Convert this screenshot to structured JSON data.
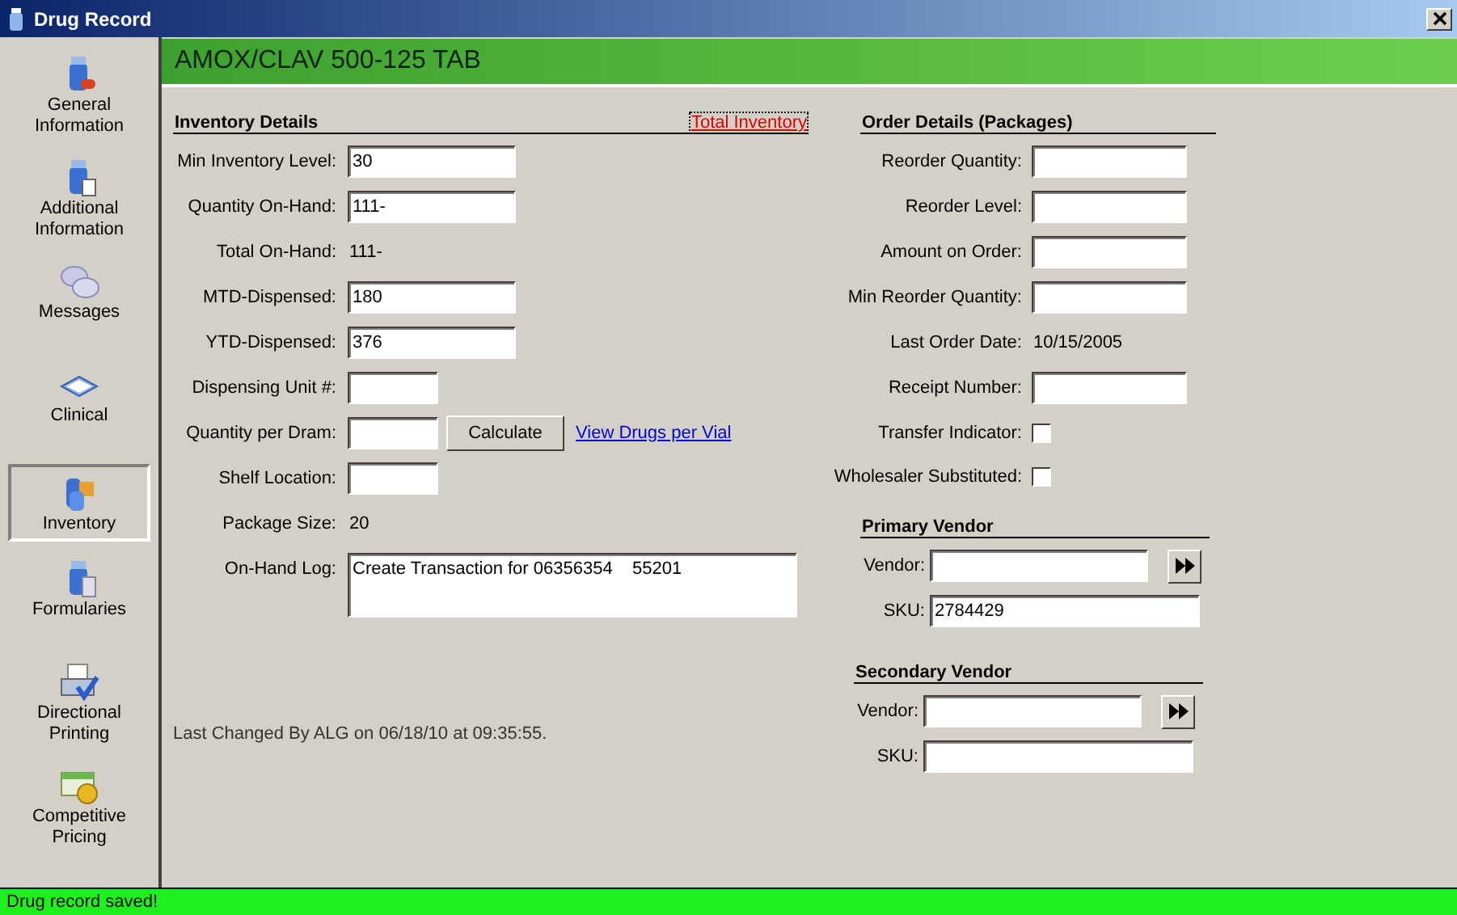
{
  "window": {
    "title": "Drug Record"
  },
  "sidebar": {
    "items": [
      {
        "label": "General Information",
        "selected": false
      },
      {
        "label": "Additional Information",
        "selected": false
      },
      {
        "label": "Messages",
        "selected": false
      },
      {
        "label": "Clinical",
        "selected": false
      },
      {
        "label": "Inventory",
        "selected": true
      },
      {
        "label": "Formularies",
        "selected": false
      },
      {
        "label": "Directional Printing",
        "selected": false
      },
      {
        "label": "Competitive Pricing",
        "selected": false
      }
    ]
  },
  "header": {
    "title": "AMOX/CLAV 500-125 TAB"
  },
  "inventory_details": {
    "title": "Inventory Details",
    "link": "Total Inventory",
    "rows": [
      {
        "kind": "field",
        "label": "Min Inventory Level:",
        "value": "30"
      },
      {
        "kind": "field",
        "label": "Quantity On-Hand:",
        "value": "111-"
      },
      {
        "kind": "text",
        "label": "Total On-Hand:",
        "value": "111-"
      },
      {
        "kind": "field",
        "label": "MTD-Dispensed:",
        "value": "180"
      },
      {
        "kind": "field",
        "label": "YTD-Dispensed:",
        "value": "376"
      },
      {
        "kind": "short",
        "label": "Dispensing Unit #:"
      },
      {
        "kind": "calc",
        "label": "Quantity per Dram:",
        "button": "Calculate",
        "link": "View Drugs per Vial"
      },
      {
        "kind": "short",
        "label": "Shelf Location:"
      },
      {
        "kind": "text",
        "label": "Package Size:",
        "value": "20"
      },
      {
        "kind": "log",
        "label": "On-Hand Log:",
        "value": "Create Transaction for 06356354    55201"
      }
    ],
    "last_changed": "Last Changed By ALG on 06/18/10 at 09:35:55."
  },
  "order_details": {
    "title": "Order Details (Packages)",
    "rows": [
      {
        "kind": "field",
        "label": "Reorder Quantity:"
      },
      {
        "kind": "field",
        "label": "Reorder Level:"
      },
      {
        "kind": "field",
        "label": "Amount on Order:"
      },
      {
        "kind": "field",
        "label": "Min Reorder Quantity:"
      },
      {
        "kind": "text",
        "label": "Last Order Date:",
        "value": "10/15/2005"
      },
      {
        "kind": "field",
        "label": "Receipt Number:"
      },
      {
        "kind": "checkbox",
        "label": "Transfer Indicator:",
        "checked": false
      },
      {
        "kind": "checkbox",
        "label": "Wholesaler Substituted:",
        "checked": false
      }
    ]
  },
  "vendors": [
    {
      "title": "Primary Vendor",
      "vendor_label": "Vendor:",
      "sku_label": "SKU:",
      "sku": "2784429"
    },
    {
      "title": "Secondary Vendor",
      "vendor_label": "Vendor:",
      "sku_label": "SKU:"
    }
  ],
  "status_bar": {
    "text": "Drug record saved!"
  }
}
